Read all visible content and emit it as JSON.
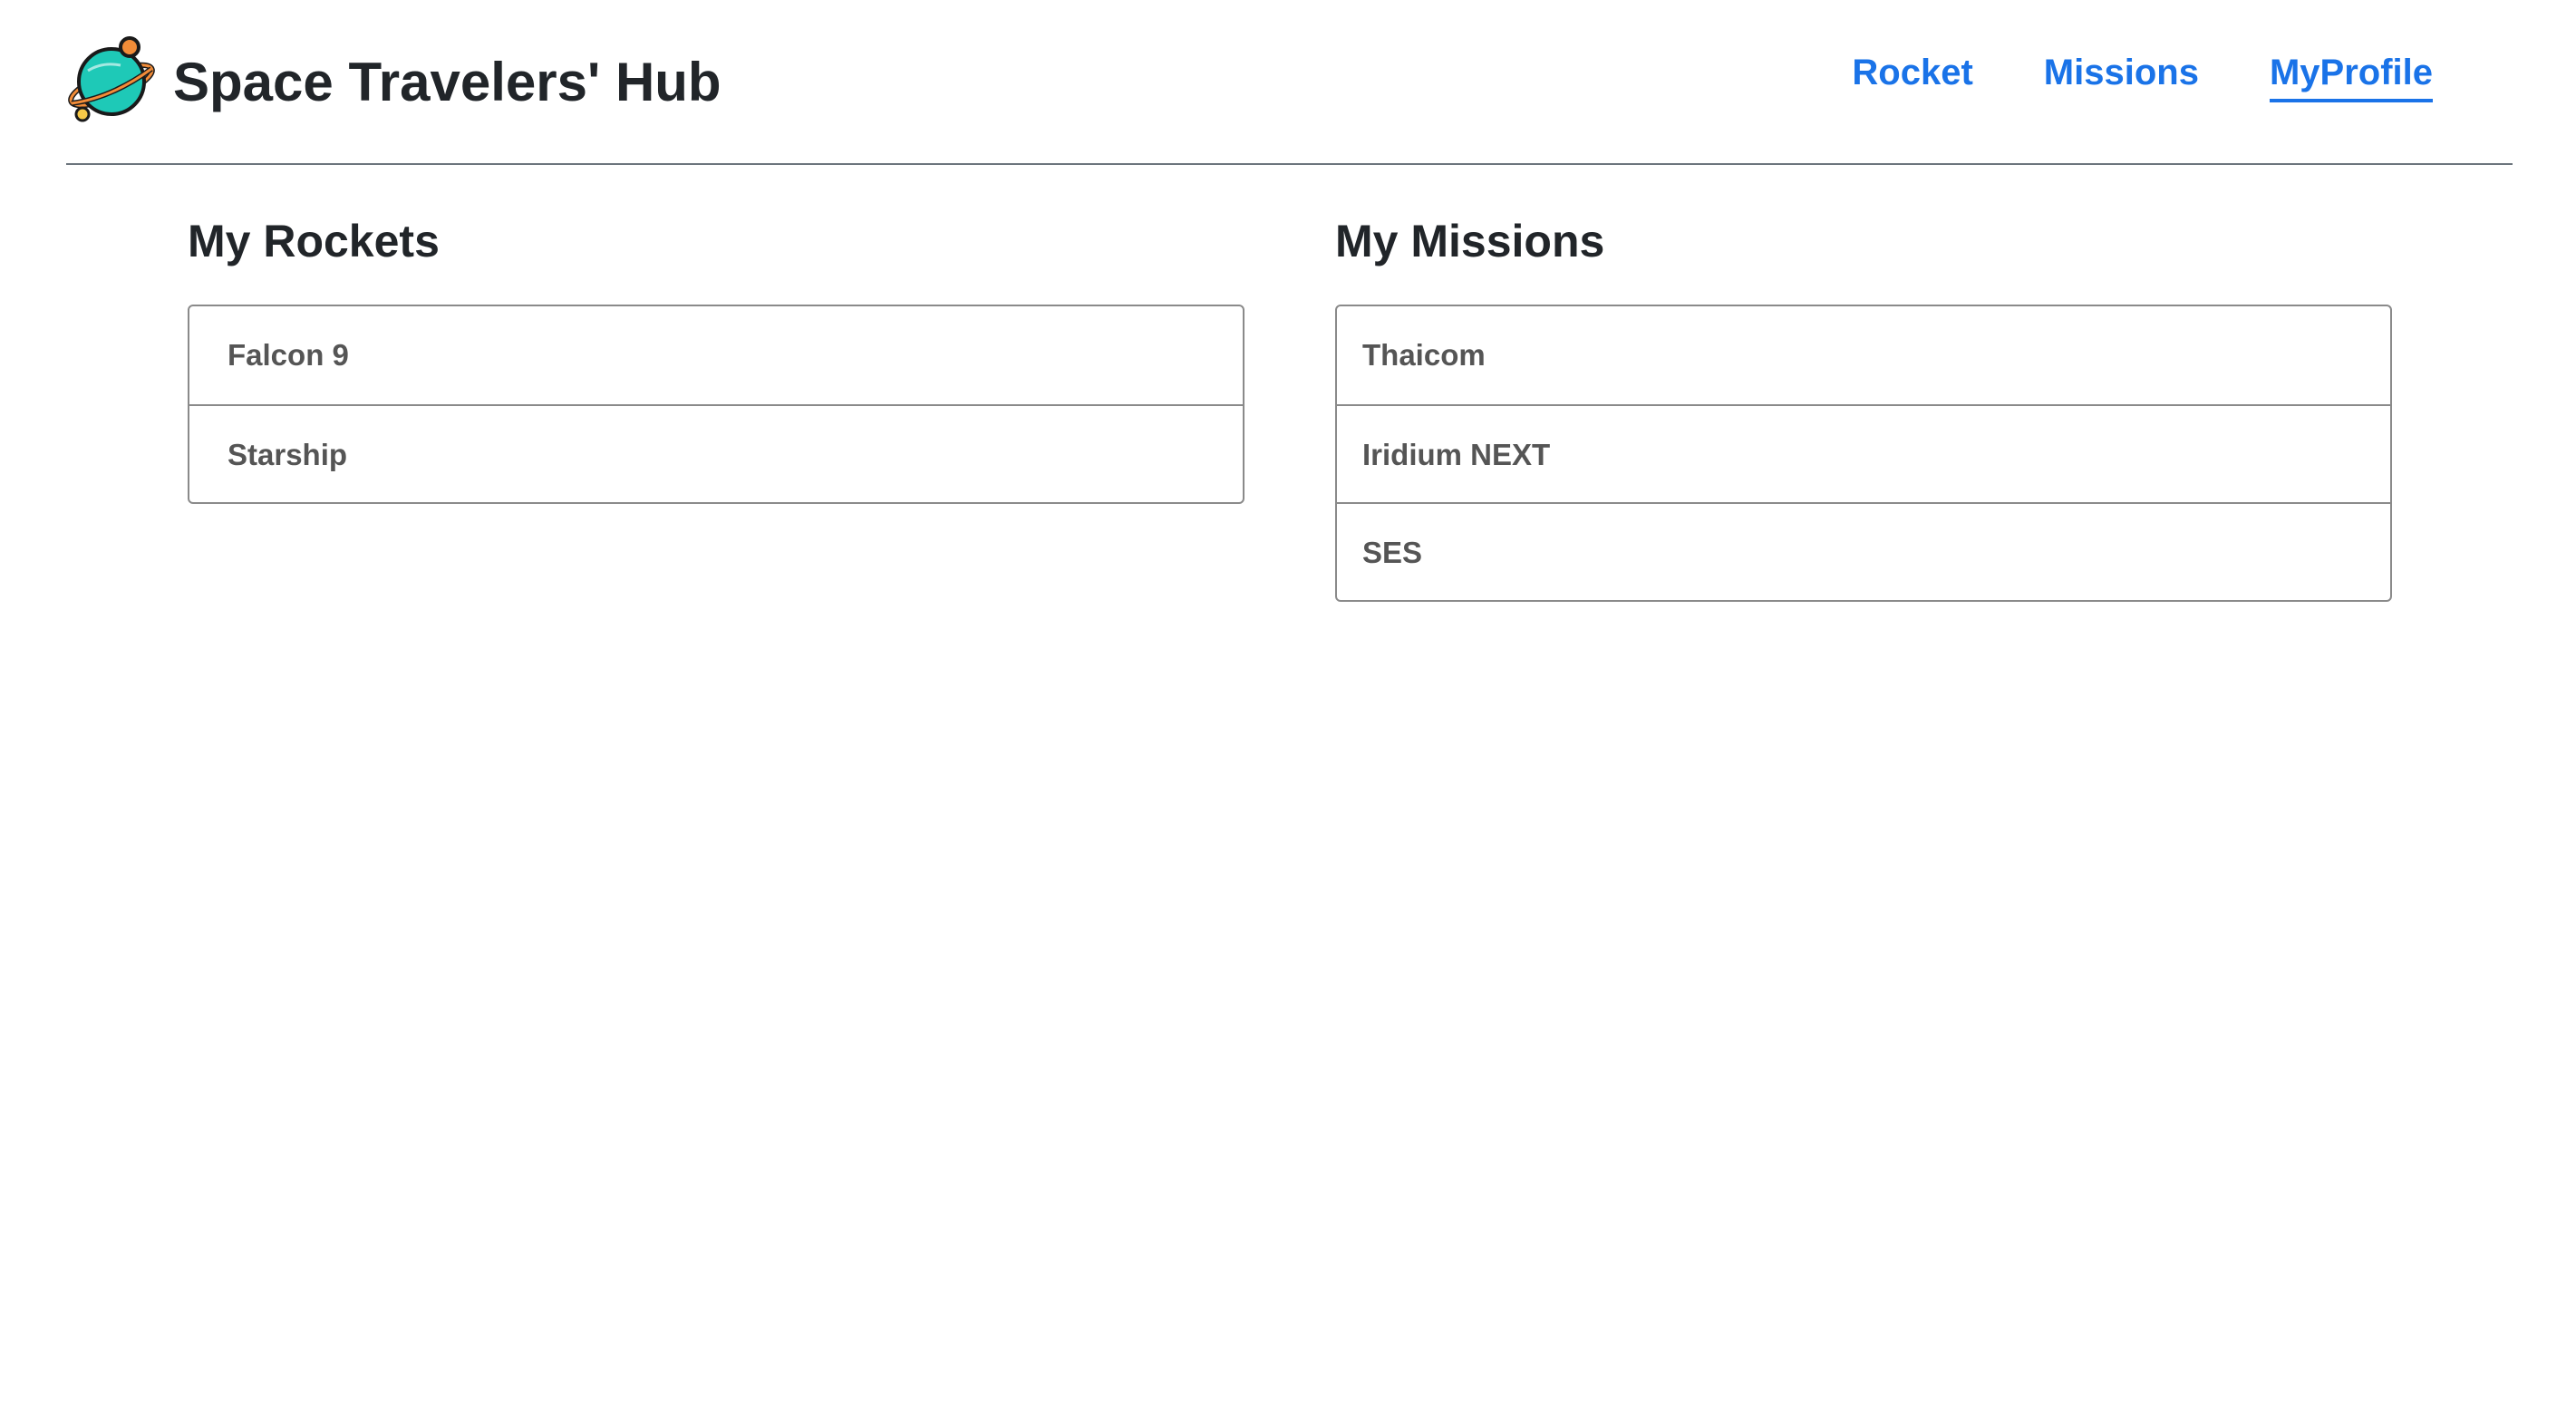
{
  "app": {
    "title": "Space Travelers' Hub",
    "logo_icon": "planet-icon"
  },
  "nav": {
    "items": [
      {
        "label": "Rocket",
        "active": false
      },
      {
        "label": "Missions",
        "active": false
      },
      {
        "label": "MyProfile",
        "active": true
      }
    ]
  },
  "rockets": {
    "title": "My Rockets",
    "items": [
      "Falcon 9",
      "Starship"
    ]
  },
  "missions": {
    "title": "My Missions",
    "items": [
      "Thaicom",
      "Iridium NEXT",
      "SES"
    ]
  },
  "colors": {
    "link": "#1a73e8",
    "planet": "#1ec9b7",
    "planet_accent": "#f28c38"
  }
}
